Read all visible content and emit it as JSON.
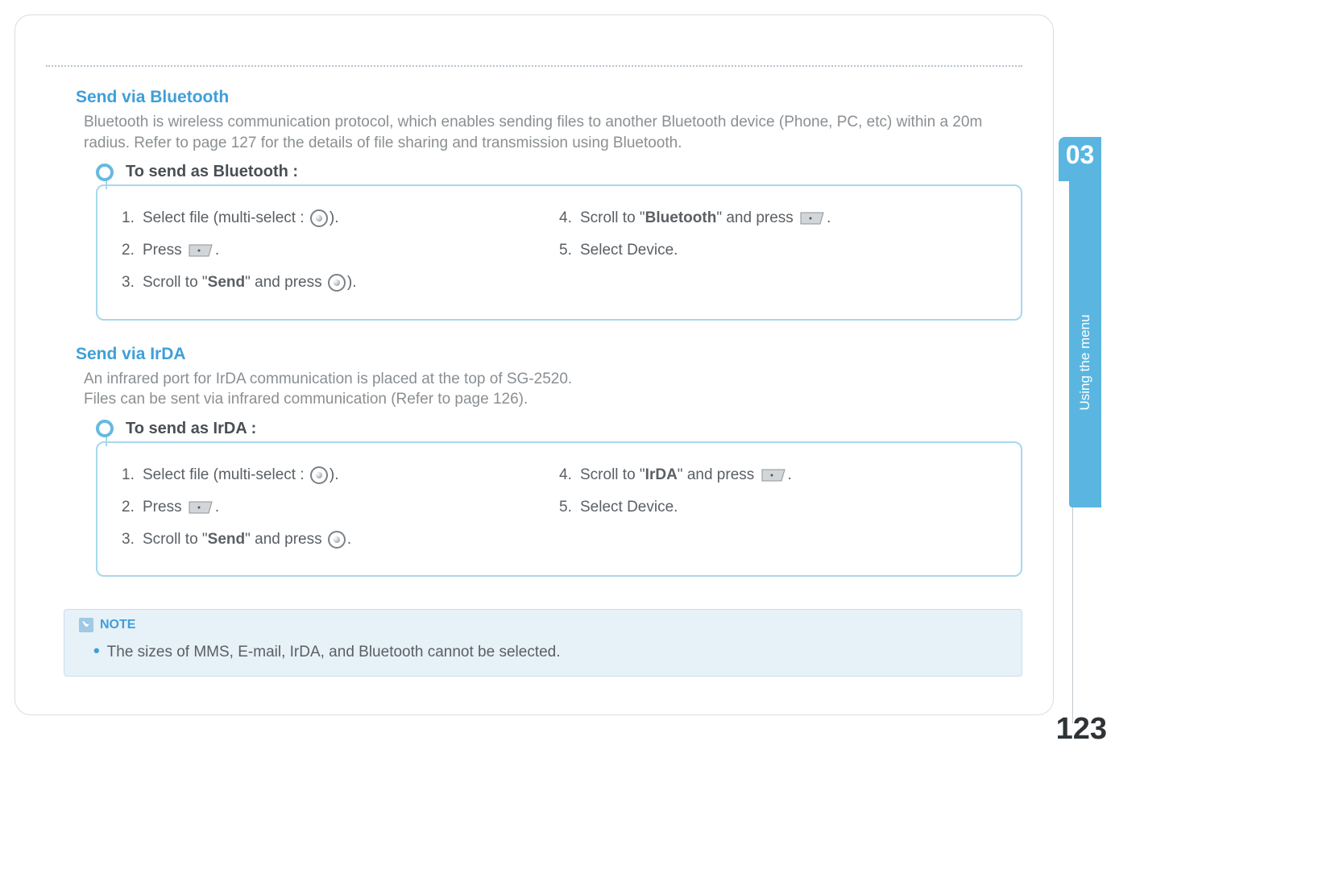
{
  "chapter_no": "03",
  "side_label": "Using the menu",
  "page_number": "123",
  "section1": {
    "title": "Send via Bluetooth",
    "body": "Bluetooth is wireless communication protocol, which enables sending files to another Bluetooth device (Phone, PC, etc) within a 20m radius. Refer to page 127 for the details of file sharing and transmission using Bluetooth.",
    "callout_title": "To send as Bluetooth :",
    "steps_left": {
      "s1_pre": "Select file (multi-select : ",
      "s1_post": ").",
      "s2_pre": "Press ",
      "s2_post": ".",
      "s3_pre": "Scroll to \"",
      "s3_bold": "Send",
      "s3_mid": "\" and press ",
      "s3_post": ")."
    },
    "steps_right": {
      "s4_pre": "Scroll to \"",
      "s4_bold": "Bluetooth",
      "s4_mid": "\" and press  ",
      "s4_post": ".",
      "s5": "Select Device."
    }
  },
  "section2": {
    "title": "Send via IrDA",
    "body_line1": "An infrared port for IrDA communication is placed at the top of SG-2520.",
    "body_line2": "Files can be sent via infrared communication (Refer to page 126).",
    "callout_title": "To send as IrDA :",
    "steps_left": {
      "s1_pre": "Select file (multi-select : ",
      "s1_post": ").",
      "s2_pre": "Press ",
      "s2_post": ".",
      "s3_pre": "Scroll to \"",
      "s3_bold": "Send",
      "s3_mid": "\" and press ",
      "s3_post": "."
    },
    "steps_right": {
      "s4_pre": "Scroll to \"",
      "s4_bold": "IrDA",
      "s4_mid": "\" and press ",
      "s4_post": ".",
      "s5": "Select Device."
    }
  },
  "note": {
    "label": "NOTE",
    "text": "The sizes of MMS, E-mail, IrDA, and Bluetooth cannot be selected."
  }
}
